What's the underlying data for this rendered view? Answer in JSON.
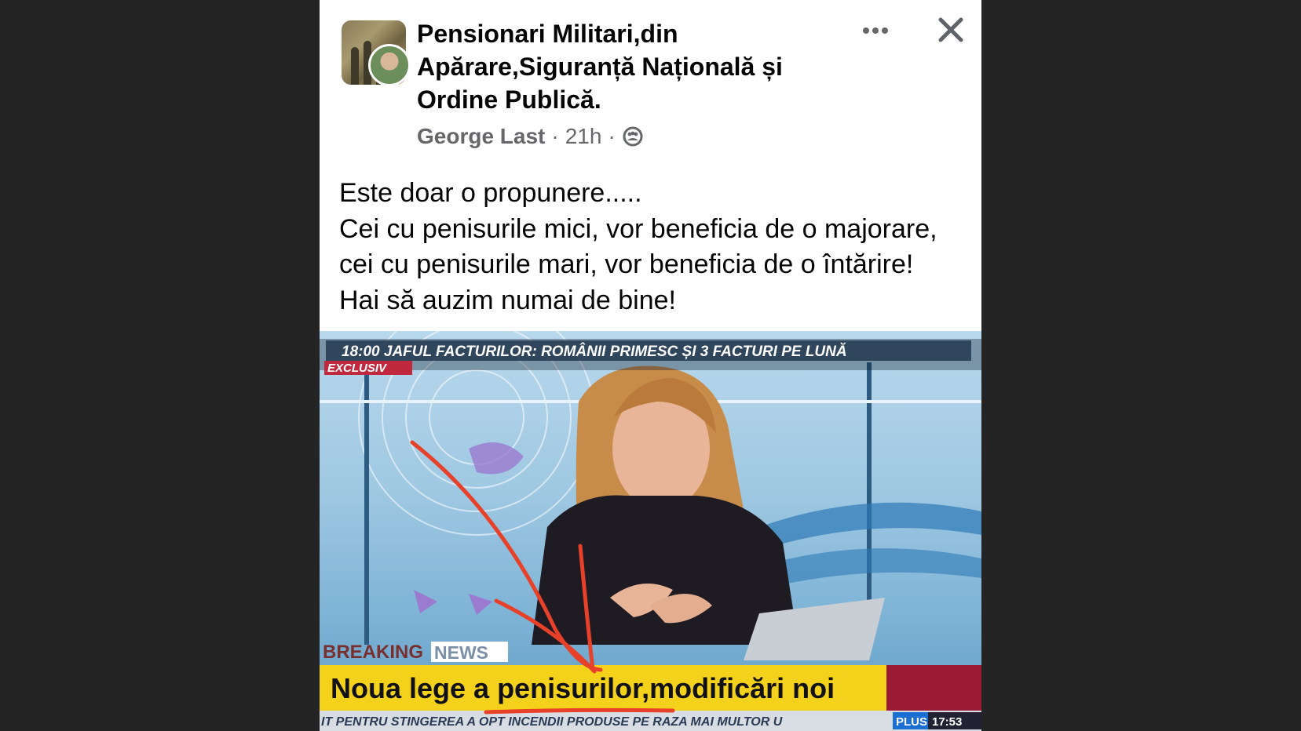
{
  "post": {
    "group_name_lines": [
      "Pensionari Militari,din",
      "Apărare,Siguranță Națională și",
      "Ordine Publică."
    ],
    "author": "George Last",
    "separator": "·",
    "time": "21h",
    "audience_icon": "group-audience-icon",
    "text_lines": [
      "Este doar o propunere.....",
      "Cei cu penisurile mici, vor beneficia de o majorare,",
      "cei cu penisurile mari, vor beneficia de o întărire!",
      "Hai să auzim numai de bine!"
    ]
  },
  "photo": {
    "ticker_top": "18:00 JAFUL FACTURILOR: ROMÂNII PRIMESC ȘI 3 FACTURI PE LUNĂ",
    "exclusive_label": "EXCLUSIV",
    "breaking_label": "BREAKING",
    "news_label": "NEWS",
    "headline": "Noua lege a penisurilor,modificări noi",
    "ticker_bottom": "IT PENTRU STINGEREA A OPT INCENDII PRODUSE PE RAZA MAI MULTOR U",
    "channel_label": "PLUS",
    "clock": "17:53",
    "annotation_color": "#e8412a",
    "banner_color": "#f4d11a"
  },
  "icons": {
    "more": "more-options-icon",
    "close": "close-icon"
  }
}
